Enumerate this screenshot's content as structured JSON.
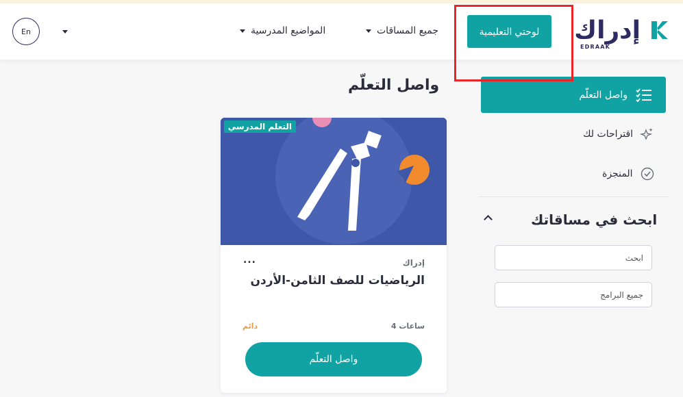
{
  "header": {
    "logo_text": "إدراك",
    "logo_sub": "EDRAAK",
    "dashboard_button": "لوحتي التعليمية",
    "nav": [
      {
        "label": "جميع المساقات"
      },
      {
        "label": "المواضيع المدرسية"
      }
    ],
    "lang_button": "En"
  },
  "sidebar": {
    "active_item": "واصل التعلّم",
    "items": [
      {
        "label": "اقتراحات لك",
        "icon": "sparkle-star-icon"
      },
      {
        "label": "المنجزة",
        "icon": "check-badge-icon"
      }
    ],
    "search_title": "ابحث في مساقاتك",
    "search_placeholder": "ابحث",
    "programs_select": "جميع البرامج"
  },
  "main": {
    "title": "واصل التعلّم",
    "card": {
      "tag": "التعلم المدرسي",
      "provider": "إدراك",
      "more": "...",
      "course_title": "الرياضيات للصف الثامن-الأردن",
      "duration": "4 ساعات",
      "status": "دائم",
      "button": "واصل التعلّم"
    }
  },
  "colors": {
    "accent": "#11a3a3",
    "brand": "#2e2a62",
    "highlight": "#e8262a",
    "card_image_bg": "#3f57a8",
    "status": "#e89a3c"
  }
}
